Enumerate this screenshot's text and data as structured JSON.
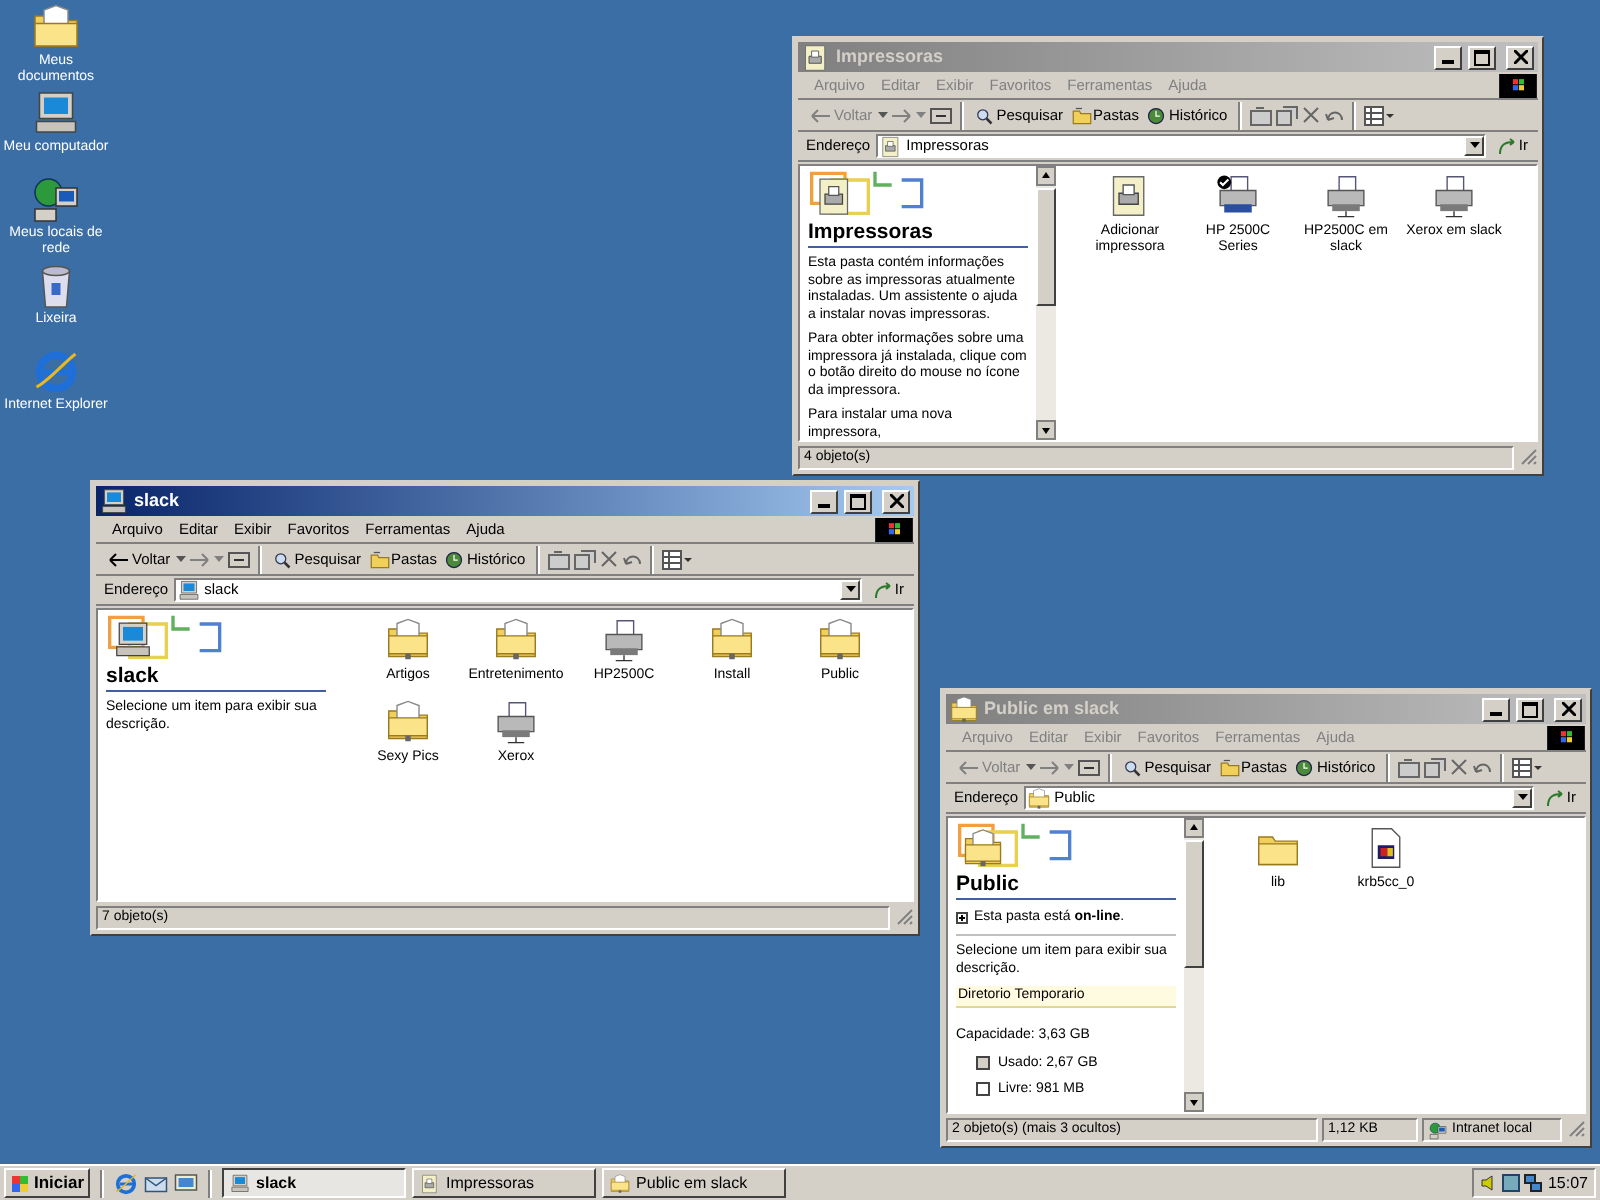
{
  "desktop_icons": [
    {
      "label": "Meus documentos",
      "kind": "documents"
    },
    {
      "label": "Meu computador",
      "kind": "computer"
    },
    {
      "label": "Meus locais de rede",
      "kind": "network"
    },
    {
      "label": "Lixeira",
      "kind": "recycle"
    },
    {
      "label": "Internet Explorer",
      "kind": "browser"
    }
  ],
  "windows": [
    {
      "title": "Impressoras",
      "active": false,
      "menu": [
        "Arquivo",
        "Editar",
        "Exibir",
        "Favoritos",
        "Ferramentas",
        "Ajuda"
      ],
      "toolbar": {
        "back": {
          "label": "Voltar",
          "disabled": true
        },
        "buttons": [
          "Pesquisar",
          "Pastas",
          "Histórico"
        ]
      },
      "address": {
        "label": "Endereço",
        "value": "Impressoras",
        "go": "Ir"
      },
      "panel": {
        "title": "Impressoras",
        "scrollbar": true,
        "blocks": [
          {
            "kind": "text",
            "text": "Esta pasta contém informações sobre as impressoras atualmente instaladas. Um assistente o ajuda a instalar novas impressoras."
          },
          {
            "kind": "text",
            "text": "Para obter informações sobre uma impressora já instalada, clique com o botão direito do mouse no ícone da impressora."
          },
          {
            "kind": "text",
            "text": "Para instalar uma nova impressora,"
          }
        ]
      },
      "items": [
        {
          "label": "Adicionar impressora",
          "kind": "add-printer"
        },
        {
          "label": "HP 2500C Series",
          "kind": "default-printer"
        },
        {
          "label": "HP2500C em slack",
          "kind": "network-printer"
        },
        {
          "label": "Xerox em slack",
          "kind": "network-printer"
        }
      ],
      "status_bar": [
        {
          "text": "4 objeto(s)",
          "kind": "text"
        }
      ]
    },
    {
      "title": "slack",
      "active": true,
      "menu": [
        "Arquivo",
        "Editar",
        "Exibir",
        "Favoritos",
        "Ferramentas",
        "Ajuda"
      ],
      "toolbar": {
        "back": {
          "label": "Voltar",
          "disabled": false
        },
        "buttons": [
          "Pesquisar",
          "Pastas",
          "Histórico"
        ]
      },
      "address": {
        "label": "Endereço",
        "value": "slack",
        "go": "Ir"
      },
      "panel": {
        "title": "slack",
        "scrollbar": false,
        "blocks": [
          {
            "kind": "text",
            "text": "Selecione um item para exibir sua descrição."
          }
        ]
      },
      "items": [
        {
          "label": "Artigos",
          "kind": "shared-folder"
        },
        {
          "label": "Entretenimento",
          "kind": "shared-folder"
        },
        {
          "label": "HP2500C",
          "kind": "printer"
        },
        {
          "label": "Install",
          "kind": "shared-folder"
        },
        {
          "label": "Public",
          "kind": "shared-folder"
        },
        {
          "label": "Sexy Pics",
          "kind": "shared-folder"
        },
        {
          "label": "Xerox",
          "kind": "printer"
        }
      ],
      "status_bar": [
        {
          "text": "7 objeto(s)",
          "kind": "text"
        }
      ]
    },
    {
      "title": "Public em slack",
      "active": false,
      "menu": [
        "Arquivo",
        "Editar",
        "Exibir",
        "Favoritos",
        "Ferramentas",
        "Ajuda"
      ],
      "toolbar": {
        "back": {
          "label": "Voltar",
          "disabled": true
        },
        "buttons": [
          "Pesquisar",
          "Pastas",
          "Histórico"
        ]
      },
      "address": {
        "label": "Endereço",
        "value": "Public",
        "go": "Ir"
      },
      "panel": {
        "title": "Public",
        "scrollbar": true,
        "blocks": [
          {
            "kind": "online",
            "text": "Esta pasta está **on-line**."
          },
          {
            "kind": "text",
            "text": "Selecione um item para exibir sua descrição."
          },
          {
            "kind": "highlight",
            "text": "Diretorio Temporario"
          },
          {
            "kind": "text",
            "text": "Capacidade: 3,63 GB"
          },
          {
            "kind": "legend",
            "text": "Usado: 2,67 GB",
            "color": "#d4d0c8"
          },
          {
            "kind": "legend",
            "text": "Livre: 981 MB",
            "color": "#ffffff"
          }
        ]
      },
      "items": [
        {
          "label": "lib",
          "kind": "folder"
        },
        {
          "label": "krb5cc_0",
          "kind": "file"
        }
      ],
      "status_bar": [
        {
          "text": "2 objeto(s) (mais 3 ocultos)",
          "kind": "text"
        },
        {
          "text": "1,12 KB",
          "kind": "text"
        },
        {
          "text": "Intranet local",
          "kind": "zone"
        }
      ]
    }
  ],
  "taskbar": {
    "start": "Iniciar",
    "tasks": [
      {
        "label": "slack",
        "selected": true
      },
      {
        "label": "Impressoras",
        "selected": false
      },
      {
        "label": "Public em slack",
        "selected": false
      }
    ],
    "clock": "15:07"
  }
}
